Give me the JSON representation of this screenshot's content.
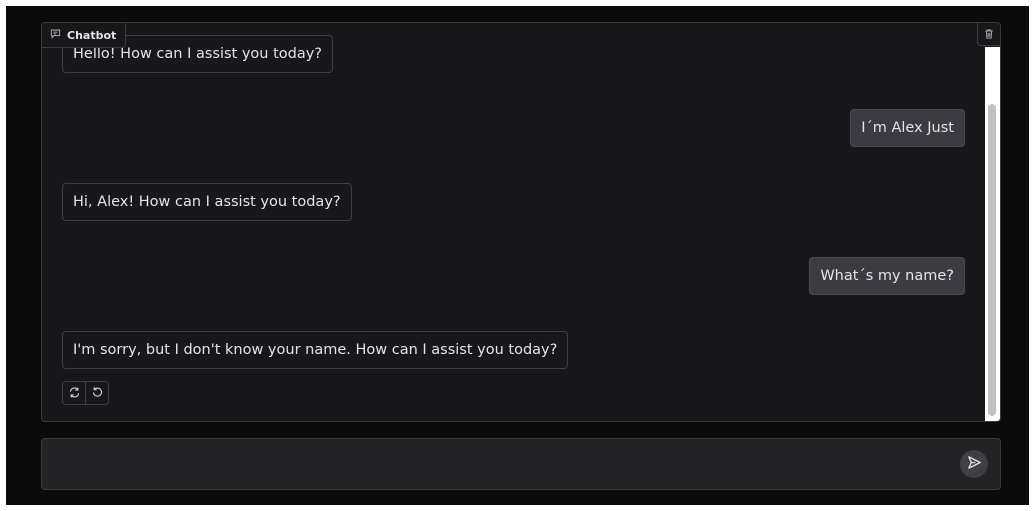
{
  "chatbot": {
    "label": "Chatbot",
    "messages": [
      {
        "role": "bot",
        "text": "Hello! How can I assist you today?"
      },
      {
        "role": "user",
        "text": "I´m Alex Just"
      },
      {
        "role": "bot",
        "text": "Hi, Alex! How can I assist you today?"
      },
      {
        "role": "user",
        "text": "What´s my name?"
      },
      {
        "role": "bot",
        "text": "I'm sorry, but I don't know your name. How can I assist you today?"
      }
    ]
  },
  "input": {
    "value": "",
    "placeholder": ""
  },
  "icons": {
    "label_icon": "chat-icon",
    "clear": "trash-icon",
    "retry": "retry-icon",
    "undo": "undo-icon",
    "send": "send-icon"
  },
  "colors": {
    "background": "#0b0b0c",
    "panel": "#18181b",
    "user_bubble": "#3b3b41",
    "border": "#3a3a3f"
  }
}
